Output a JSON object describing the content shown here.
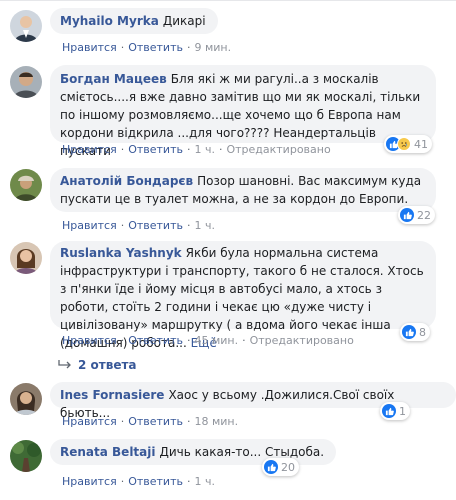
{
  "actions": {
    "like": "Нравится",
    "reply": "Ответить"
  },
  "comments": [
    {
      "author": "Myhailo Myrka",
      "text": "Дикарі",
      "time": "9 мин."
    },
    {
      "author": "Богдан Мацеев",
      "text": "Бля які ж ми рагулі..а з москалів смієтось....я вже давно замітив що ми як москалі, тільки по іншому розмовляємо...ще хочемо що б Европа нам кордони відкрила ...для чого???? Неандертальців пускати",
      "time": "1 ч.",
      "edited": "Отредактировано",
      "reactions": "41"
    },
    {
      "author": "Анатолій Бондарєв",
      "text": "Позор шановні. Вас максимум куда пускати це в туалет можна, а не за кордон до Европи.",
      "time": "1 ч.",
      "reactions": "22"
    },
    {
      "author": "Ruslanka Yashnyk",
      "text": "Якби була нормальна система інфраструктури і транспорту, такого б не сталося. Хтось з п'янки їде і йому місця в автобусі мало, а хтось з роботи, стоїть 2 години і чекає цю «дуже чисту і цивілізовану» маршрутку ( а вдома його чекає інша (домашня) робота...",
      "more": "Ещё",
      "time": "45 мин.",
      "edited": "Отредактировано",
      "reactions": "8",
      "replies": "2 ответа"
    },
    {
      "author": "Ines Fornasiere",
      "text": "Хаос у всьому .Дожилися.Свої своїх бьють...",
      "time": "18 мин.",
      "reactions": "1"
    },
    {
      "author": "Renata Beltaji",
      "text": "Дичь какая-то... Стыдоба.",
      "time": "1 ч.",
      "reactions": "20"
    }
  ],
  "colors": {
    "author": "#385898",
    "bubble": "#f2f3f5",
    "meta": "#90949c",
    "like": "#1877f2",
    "sad": "#f7c94b"
  }
}
